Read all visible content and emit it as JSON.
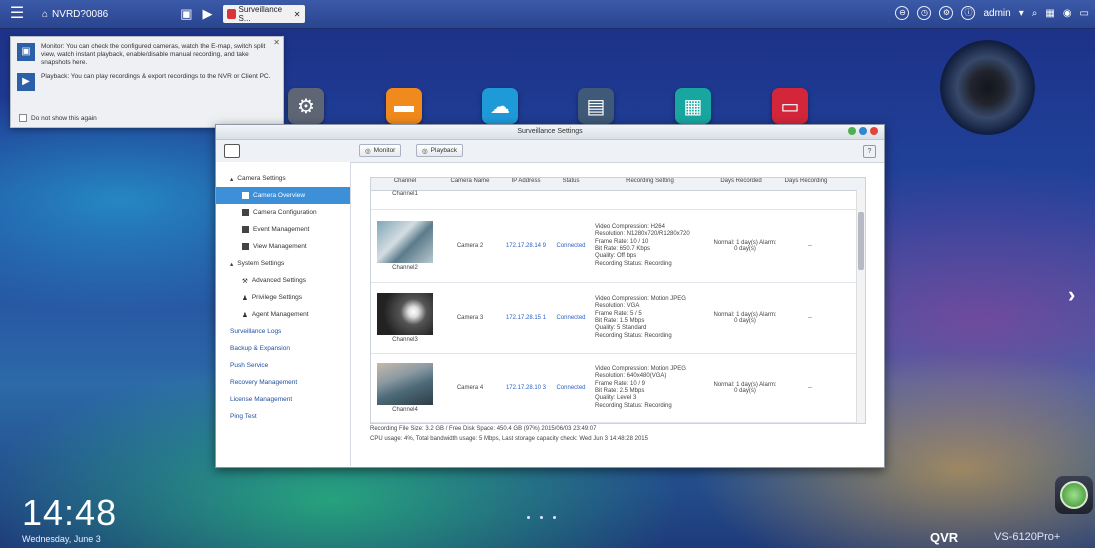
{
  "topbar": {
    "home_label": "NVRD?0086",
    "tab_label": "Surveillance S...",
    "user_label": "admin"
  },
  "tooltip": {
    "monitor_text": "Monitor: You can check the configured cameras, watch the E-map, switch split view, watch instant playback, enable/disable manual recording, and take snapshots here.",
    "playback_text": "Playback: You can play recordings & export recordings to the NVR or Client PC.",
    "dont_show": "Do not show this again"
  },
  "window": {
    "title": "Surveillance Settings",
    "monitor_btn": "Monitor",
    "playback_btn": "Playback",
    "help": "?",
    "sidebar": {
      "camera_settings": "Camera Settings",
      "camera_overview": "Camera Overview",
      "camera_configuration": "Camera Configuration",
      "event_management": "Event Management",
      "view_management": "View Management",
      "system_settings": "System Settings",
      "advanced_settings": "Advanced Settings",
      "privilege_settings": "Privilege Settings",
      "agent_management": "Agent Management",
      "surveillance_logs": "Surveillance Logs",
      "backup_expansion": "Backup & Expansion",
      "push_service": "Push Service",
      "recovery_management": "Recovery Management",
      "license_management": "License Management",
      "ping_test": "Ping Test"
    },
    "table": {
      "headers": [
        "Channel",
        "Camera Name",
        "IP Address",
        "Status",
        "Recording Setting",
        "Days Recorded",
        "Days Recording"
      ],
      "first_channel": "Channel1",
      "rows": [
        {
          "channel": "Channel2",
          "name": "Camera 2",
          "ip": "172.17.28.14 9",
          "status": "Connected",
          "rec": [
            "Video Compression: H264",
            "Resolution: N1280x720/R1280x720",
            "Frame Rate: 10 / 10",
            "Bit Rate: 650.7 Kbps",
            "Quality: Off bps",
            "Recording Status: Recording"
          ],
          "days_recorded": "Normal: 1 day(s) Alarm: 0 day(s)",
          "days_recording": "--"
        },
        {
          "channel": "Channel3",
          "name": "Camera 3",
          "ip": "172.17.28.15 1",
          "status": "Connected",
          "rec": [
            "Video Compression: Motion JPEG",
            "Resolution: VGA",
            "Frame Rate: 5 / 5",
            "Bit Rate: 1.5 Mbps",
            "Quality: 5 Standard",
            "Recording Status: Recording"
          ],
          "days_recorded": "Normal: 1 day(s) Alarm: 0 day(s)",
          "days_recording": "--"
        },
        {
          "channel": "Channel4",
          "name": "Camera 4",
          "ip": "172.17.28.10 3",
          "status": "Connected",
          "rec": [
            "Video Compression: Motion JPEG",
            "Resolution: 640x480(VGA)",
            "Frame Rate: 10 / 9",
            "Bit Rate: 2.5 Mbps",
            "Quality: Level 3",
            "Recording Status: Recording"
          ],
          "days_recorded": "Normal: 1 day(s) Alarm: 0 day(s)",
          "days_recording": "--"
        }
      ]
    },
    "status_line1": "Recording File Size: 3.2 GB / Free Disk Space: 450.4 GB (97%) 2015/06/03 23:49:07",
    "status_line2": "CPU usage: 4%, Total bandwidth usage: 5 Mbps, Last storage capacity check: Wed Jun 3 14:48:28 2015"
  },
  "clock": "14:48",
  "clock_sub": "Wednesday, June 3",
  "brand": "QVR",
  "model": "VS-6120Pro+"
}
